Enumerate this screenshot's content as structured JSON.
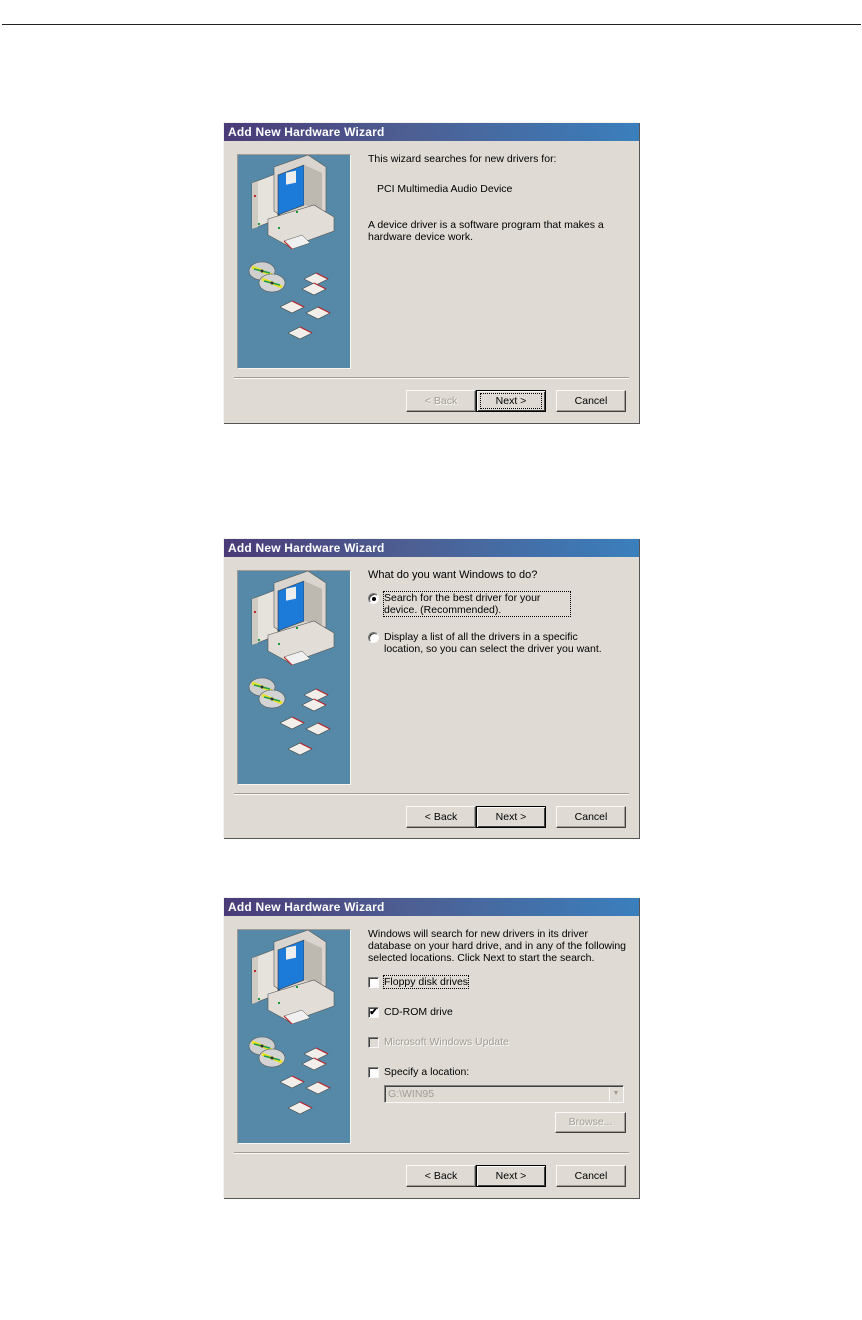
{
  "page": {
    "top_rule": true
  },
  "dialogs": [
    {
      "title": "Add New Hardware Wizard",
      "intro": "This wizard searches for new drivers for:",
      "device": "PCI Multimedia Audio Device",
      "description": "A device driver is a software program that makes a hardware device work.",
      "buttons": {
        "back": "< Back",
        "back_enabled": false,
        "next": "Next >",
        "next_focused": true,
        "cancel": "Cancel"
      }
    },
    {
      "title": "Add New Hardware Wizard",
      "question": "What do you want Windows to do?",
      "options": [
        {
          "label": "Search for the best driver for your device. (Recommended).",
          "selected": true,
          "focused": true
        },
        {
          "label": "Display a list of all the drivers in a specific location, so you can select the driver you want.",
          "selected": false,
          "focused": false
        }
      ],
      "buttons": {
        "back": "< Back",
        "back_enabled": true,
        "next": "Next >",
        "cancel": "Cancel"
      }
    },
    {
      "title": "Add New Hardware Wizard",
      "intro": "Windows will search for new drivers in its driver database on your hard drive, and in any of the following selected locations. Click Next to start the search.",
      "checkboxes": [
        {
          "label": "Floppy disk drives",
          "checked": false,
          "enabled": true,
          "focused": true
        },
        {
          "label": "CD-ROM drive",
          "checked": true,
          "enabled": true,
          "focused": false
        },
        {
          "label": "Microsoft Windows Update",
          "checked": false,
          "enabled": false,
          "focused": false
        },
        {
          "label": "Specify a location:",
          "checked": false,
          "enabled": true,
          "focused": false
        }
      ],
      "location_value": "G:\\WIN95",
      "location_enabled": false,
      "browse_label": "Browse...",
      "browse_enabled": false,
      "buttons": {
        "back": "< Back",
        "back_enabled": true,
        "next": "Next >",
        "cancel": "Cancel"
      }
    }
  ],
  "icons": {
    "check": "✔",
    "dropdown": "▼"
  },
  "colors": {
    "titlebar_start": "#4a3b78",
    "titlebar_end": "#3a7fbd",
    "dialog_face": "#dfdbd4",
    "art_background": "#5589a7"
  }
}
